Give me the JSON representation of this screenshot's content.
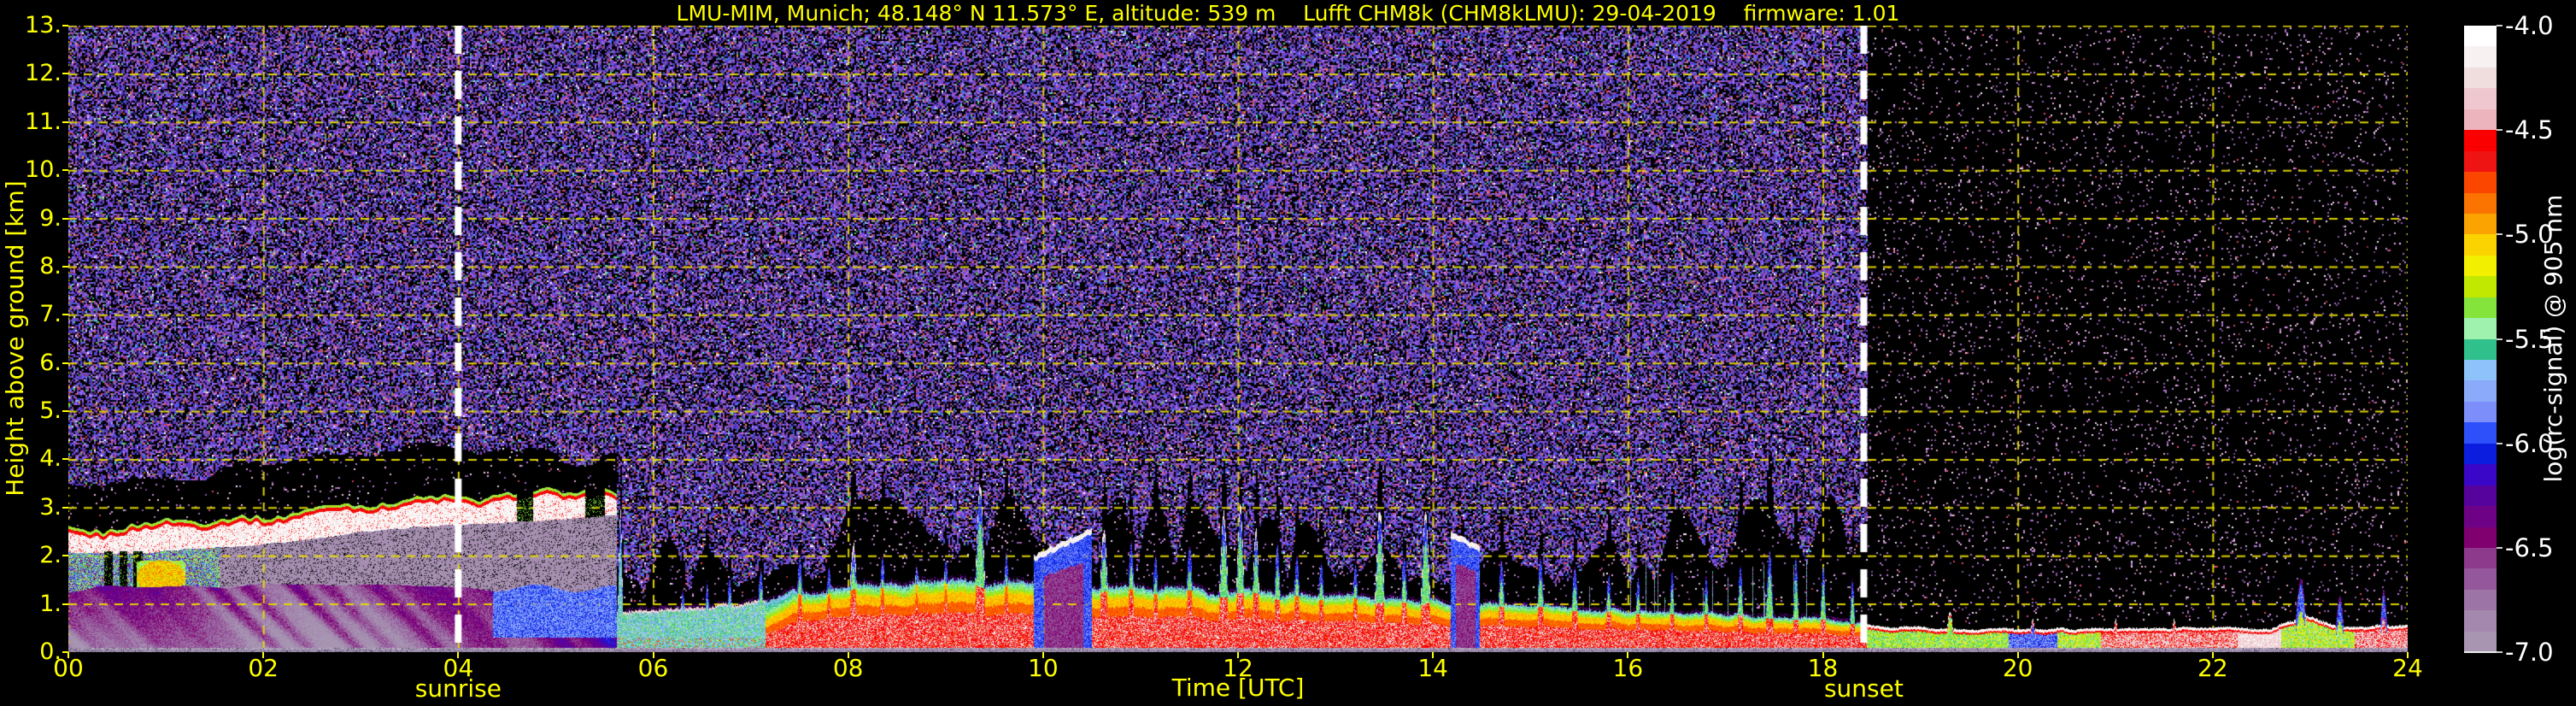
{
  "chart_data": {
    "type": "heatmap",
    "title": "LMU-MIM, Munich; 48.148° N 11.573° E, altitude: 539 m    Lufft CHM8k (CHM8kLMU): 29-04-2019    firmware: 1.01",
    "xlabel": "Time [UTC]",
    "ylabel": "Height above ground [km]",
    "colorbar_label": "log(rc-signal) @ 905 nm",
    "xlim": [
      0,
      24
    ],
    "ylim": [
      0,
      13
    ],
    "grid": "dashed yellow, 2 h x 1 km",
    "legend_position": "right colorbar",
    "title_color": "#ffff00",
    "axis_color": "#ffff00",
    "colorbar_text_color": "#ffffff",
    "background_color": "#000000",
    "xticks": [
      "00",
      "02",
      "04",
      "06",
      "08",
      "10",
      "12",
      "14",
      "16",
      "18",
      "20",
      "22",
      "24"
    ],
    "xtick_hours": [
      0,
      2,
      4,
      6,
      8,
      10,
      12,
      14,
      16,
      18,
      20,
      22,
      24
    ],
    "yticks": [
      "13.",
      "12.",
      "11.",
      "10.",
      "9.",
      "8.",
      "7.",
      "6.",
      "5.",
      "4.",
      "3.",
      "2.",
      "1.",
      "0."
    ],
    "ytick_values": [
      13,
      12,
      11,
      10,
      9,
      8,
      7,
      6,
      5,
      4,
      3,
      2,
      1,
      0
    ],
    "colorbar_ticks": [
      "-4.0",
      "-4.5",
      "-5.0",
      "-5.5",
      "-6.0",
      "-6.5",
      "-7.0"
    ],
    "colorbar_tick_values": [
      -4.0,
      -4.5,
      -5.0,
      -5.5,
      -6.0,
      -6.5,
      -7.0
    ],
    "colorbar_range": [
      -7.0,
      -4.0
    ],
    "palette_top_to_bottom": [
      "#ffffff",
      "#f8f1f1",
      "#f0dede",
      "#efc8cf",
      "#ecb4bd",
      "#fb0000",
      "#ee1414",
      "#fb4600",
      "#fb7300",
      "#fba300",
      "#fbd300",
      "#f2ef00",
      "#c0e800",
      "#84e43c",
      "#9ef2ae",
      "#2fc08b",
      "#8ec2fa",
      "#8baafa",
      "#7b8efa",
      "#2e50fa",
      "#0b1ee0",
      "#3a06c8",
      "#56039e",
      "#6d0287",
      "#800070",
      "#8d3a8d",
      "#95579b",
      "#9d74a6",
      "#a488ae",
      "#a795b2"
    ],
    "annotations": [
      {
        "label": "sunrise",
        "time_utc": 4.0
      },
      {
        "label": "sunset",
        "time_utc": 18.42
      }
    ],
    "render": {
      "gridline_color": "#e8dc00",
      "sun_line_color": "#ffffff",
      "overlap_band": {
        "height_km": 0.085,
        "color_top": "#b0a2bc",
        "color_bottom": "#8a7a98",
        "dot_color": "#584868"
      },
      "stratus": {
        "t_end": 5.62,
        "cloud_base_km": [
          [
            0,
            2.06
          ],
          [
            0.6,
            2.02
          ],
          [
            1.2,
            2.14
          ],
          [
            1.8,
            2.2
          ],
          [
            2.4,
            2.32
          ],
          [
            3,
            2.5
          ],
          [
            3.6,
            2.6
          ],
          [
            4.2,
            2.66
          ],
          [
            4.8,
            2.72
          ],
          [
            5.3,
            2.8
          ],
          [
            5.62,
            2.84
          ]
        ],
        "cloud_top_km": [
          [
            0,
            2.44
          ],
          [
            0.35,
            2.36
          ],
          [
            0.7,
            2.52
          ],
          [
            1.05,
            2.64
          ],
          [
            1.4,
            2.56
          ],
          [
            1.75,
            2.7
          ],
          [
            2.1,
            2.64
          ],
          [
            2.45,
            2.84
          ],
          [
            2.8,
            2.96
          ],
          [
            3.15,
            2.9
          ],
          [
            3.5,
            3.06
          ],
          [
            3.85,
            3.12
          ],
          [
            4.2,
            3.02
          ],
          [
            4.55,
            3.18
          ],
          [
            4.9,
            3.26
          ],
          [
            5.2,
            3.12
          ],
          [
            5.45,
            3.3
          ],
          [
            5.62,
            3.12
          ]
        ],
        "cloud_gaps": [
          [
            4.6,
            4.76
          ],
          [
            5.3,
            5.5
          ]
        ],
        "shadow_columns": [
          [
            0.36,
            0.45
          ],
          [
            0.52,
            0.6
          ],
          [
            0.66,
            0.76
          ]
        ],
        "blob": {
          "t0": 0.7,
          "t1": 1.2,
          "h0": 1.2,
          "h1": 1.9
        }
      },
      "boundary_layer_top_km": [
        [
          5.62,
          0.85
        ],
        [
          6.2,
          0.88
        ],
        [
          7,
          1.05
        ],
        [
          7.5,
          1.25
        ],
        [
          8,
          1.35
        ],
        [
          9,
          1.45
        ],
        [
          10,
          1.4
        ],
        [
          11,
          1.3
        ],
        [
          12,
          1.25
        ],
        [
          13,
          1.15
        ],
        [
          14,
          1.05
        ],
        [
          15,
          0.98
        ],
        [
          16,
          0.85
        ],
        [
          17,
          0.8
        ],
        [
          18,
          0.68
        ],
        [
          18.45,
          0.55
        ],
        [
          19,
          0.5
        ],
        [
          20,
          0.48
        ],
        [
          21,
          0.5
        ],
        [
          22,
          0.52
        ],
        [
          22.6,
          0.5
        ],
        [
          22.95,
          0.75
        ],
        [
          23.3,
          0.55
        ],
        [
          24,
          0.55
        ]
      ],
      "cloud_spikes": [
        [
          5.66,
          2.95,
          0.025
        ],
        [
          6.3,
          1.3,
          0.03
        ],
        [
          6.55,
          1.4,
          0.03
        ],
        [
          6.78,
          1.5,
          0.035
        ],
        [
          7.1,
          1.65,
          0.04
        ],
        [
          7.5,
          2.0,
          0.04
        ],
        [
          7.8,
          1.75,
          0.04
        ],
        [
          8.05,
          2.25,
          0.05
        ],
        [
          8.35,
          1.95,
          0.04
        ],
        [
          8.7,
          1.75,
          0.04
        ],
        [
          9.0,
          1.9,
          0.04
        ],
        [
          9.35,
          3.45,
          0.055
        ],
        [
          9.62,
          2.0,
          0.04
        ],
        [
          10.62,
          2.55,
          0.05
        ],
        [
          10.9,
          2.2,
          0.045
        ],
        [
          11.15,
          1.95,
          0.04
        ],
        [
          11.5,
          2.15,
          0.045
        ],
        [
          11.85,
          2.9,
          0.05
        ],
        [
          12.02,
          3.05,
          0.045
        ],
        [
          12.18,
          2.6,
          0.04
        ],
        [
          12.4,
          2.2,
          0.04
        ],
        [
          12.6,
          1.95,
          0.04
        ],
        [
          12.85,
          1.85,
          0.04
        ],
        [
          13.2,
          1.8,
          0.04
        ],
        [
          13.45,
          3.0,
          0.05
        ],
        [
          13.7,
          2.0,
          0.04
        ],
        [
          13.92,
          2.9,
          0.05
        ],
        [
          14.3,
          2.35,
          0.05
        ],
        [
          14.7,
          1.9,
          0.04
        ],
        [
          15.1,
          1.95,
          0.04
        ],
        [
          15.45,
          1.75,
          0.04
        ],
        [
          15.8,
          1.6,
          0.035
        ],
        [
          16.1,
          1.55,
          0.03
        ],
        [
          16.45,
          1.65,
          0.03
        ],
        [
          16.8,
          1.55,
          0.03
        ],
        [
          17.15,
          1.75,
          0.035
        ],
        [
          17.45,
          2.05,
          0.04
        ],
        [
          17.72,
          1.9,
          0.03
        ],
        [
          18.0,
          1.8,
          0.03
        ],
        [
          18.3,
          1.45,
          0.03
        ],
        [
          19.3,
          0.85,
          0.04
        ],
        [
          20.15,
          0.7,
          0.03
        ],
        [
          21.0,
          0.68,
          0.03
        ],
        [
          21.6,
          0.7,
          0.03
        ],
        [
          22.9,
          1.55,
          0.06
        ],
        [
          23.3,
          1.2,
          0.045
        ],
        [
          23.75,
          1.3,
          0.04
        ]
      ],
      "virga": [
        {
          "t0": 9.9,
          "t1": 10.5,
          "h0": 2.0,
          "h1": 2.58
        },
        {
          "t0": 14.18,
          "t1": 14.48,
          "h0": 2.5,
          "h1": 2.2
        }
      ],
      "night_segments": [
        {
          "t0": 18.42,
          "t1": 19.9,
          "v": -5.35,
          "w": 0.04
        },
        {
          "t0": 19.9,
          "t1": 20.4,
          "v": -5.9,
          "w": 0.02
        },
        {
          "t0": 20.4,
          "t1": 20.85,
          "v": -5.3,
          "w": 0.05
        },
        {
          "t0": 20.85,
          "t1": 22.25,
          "v": -4.5,
          "w": 0.2
        },
        {
          "t0": 22.25,
          "t1": 22.7,
          "v": -4.25,
          "w": 0.32
        },
        {
          "t0": 22.7,
          "t1": 23.45,
          "v": -5.3,
          "w": 0.06
        },
        {
          "t0": 23.45,
          "t1": 24.01,
          "v": -4.45,
          "w": 0.16
        }
      ],
      "noise": {
        "dense_coverage": 0.62,
        "sparse_coverage_day": 0.035,
        "sparse_coverage_night": 0.05,
        "dense_colors": [
          [
            "#5a3cc8",
            20
          ],
          [
            "#7a50c8",
            15
          ],
          [
            "#8a48a8",
            13
          ],
          [
            "#4830a8",
            12
          ],
          [
            "#a070d0",
            8
          ],
          [
            "#3858d8",
            7
          ],
          [
            "#6a5ae0",
            6
          ],
          [
            "#9a58b8",
            5
          ],
          [
            "#c84040",
            3
          ],
          [
            "#d07830",
            2
          ],
          [
            "#40b8b8",
            2
          ],
          [
            "#e0e0e8",
            2
          ],
          [
            "#48b048",
            2
          ],
          [
            "#c050a0",
            3
          ]
        ],
        "sparse_colors": [
          [
            "#c890c8",
            5
          ],
          [
            "#9a68b8",
            5
          ],
          [
            "#e8b0d0",
            3
          ],
          [
            "#8a58a8",
            4
          ],
          [
            "#d8d8e0",
            1
          ],
          [
            "#c84060",
            1
          ]
        ]
      }
    }
  }
}
